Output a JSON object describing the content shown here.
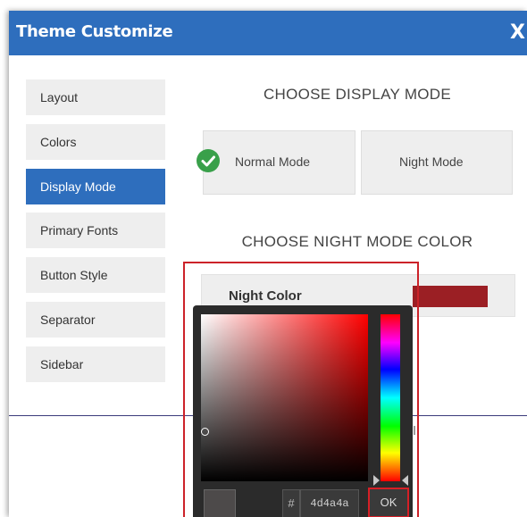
{
  "window": {
    "title": "Theme Customize",
    "close_label": "X"
  },
  "sidebar": {
    "items": [
      {
        "label": "Layout"
      },
      {
        "label": "Colors"
      },
      {
        "label": "Display Mode",
        "active": true
      },
      {
        "label": "Primary Fonts"
      },
      {
        "label": "Button Style"
      },
      {
        "label": "Separator"
      },
      {
        "label": "Sidebar"
      }
    ]
  },
  "display_mode": {
    "heading": "CHOOSE DISPLAY MODE",
    "normal_label": "Normal Mode",
    "night_label": "Night Mode",
    "selected": "normal",
    "check_icon": "check-circle-icon"
  },
  "night_mode": {
    "heading": "CHOOSE NIGHT MODE COLOR",
    "color_label": "Night Color",
    "swatch_color": "#9b1f24"
  },
  "color_picker": {
    "hash_label": "#",
    "hex_value": "4d4a4a",
    "ok_label": "OK",
    "preview_color": "#4d4a4a"
  },
  "colors": {
    "accent": "#2e6ebd",
    "check_green": "#39a04a",
    "highlight_red": "#cc2229"
  }
}
